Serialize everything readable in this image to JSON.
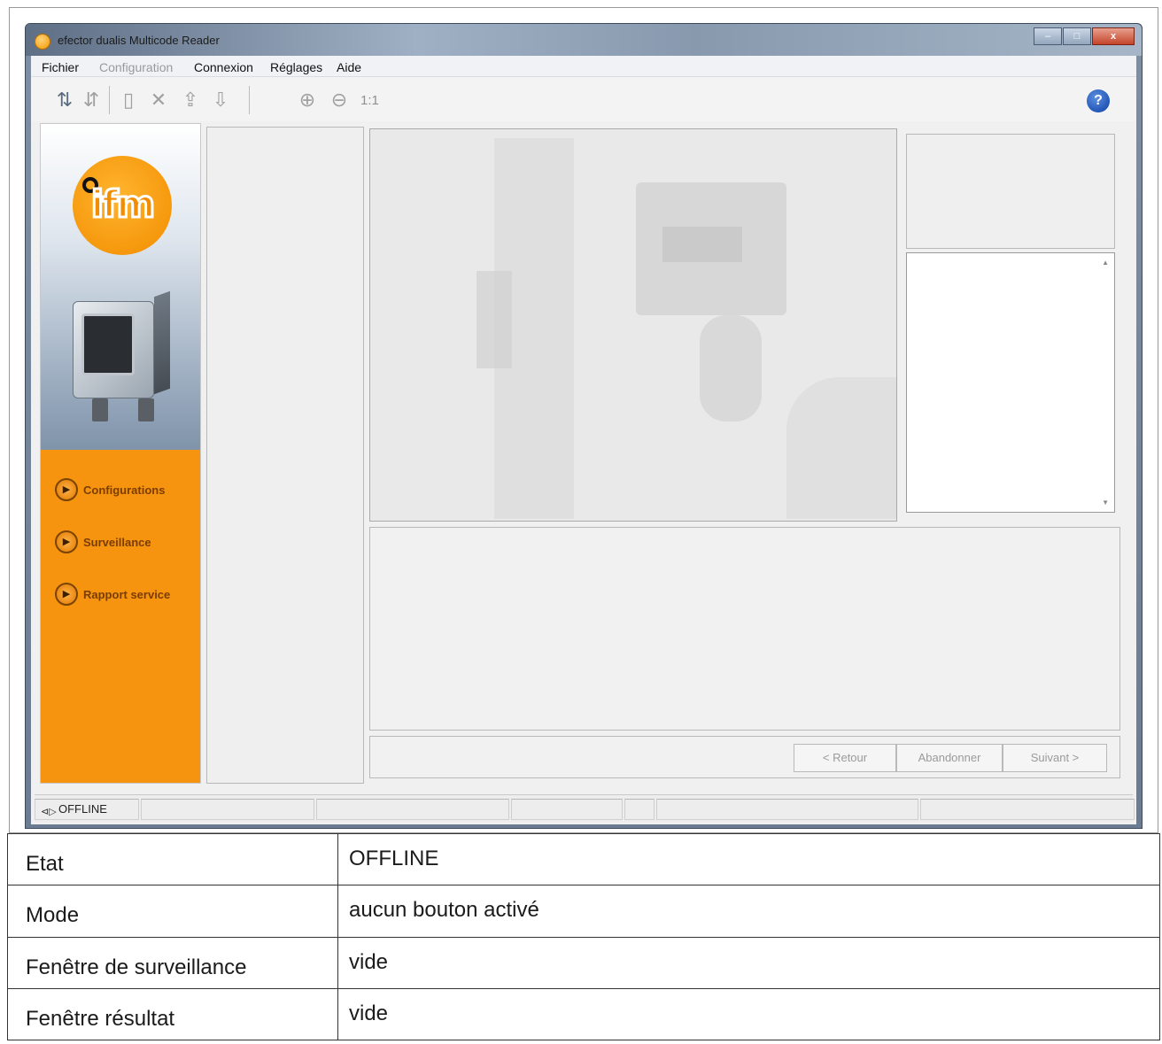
{
  "window": {
    "title": "efector dualis Multicode Reader",
    "buttons": {
      "minimize": "–",
      "maximize": "□",
      "close": "x"
    }
  },
  "menu": [
    {
      "label": "Fichier",
      "enabled": true
    },
    {
      "label": "Configuration",
      "enabled": false
    },
    {
      "label": "Connexion",
      "enabled": true
    },
    {
      "label": "Réglages",
      "enabled": true
    },
    {
      "label": "Aide",
      "enabled": true
    }
  ],
  "toolbar": {
    "icons": [
      "connect-icon",
      "disconnect-icon",
      "new-file-icon",
      "delete-icon",
      "upload-icon",
      "download-icon",
      "zoom-in-icon",
      "zoom-out-icon"
    ],
    "zoom_label": "1:1",
    "help_icon": "help-icon"
  },
  "sidebar": {
    "items": [
      {
        "label": "Configurations"
      },
      {
        "label": "Surveillance"
      },
      {
        "label": "Rapport service"
      }
    ]
  },
  "wizard": {
    "back": "< Retour",
    "abort": "Abandonner",
    "next": "Suivant >"
  },
  "status": {
    "state": "OFFLINE"
  },
  "table": [
    {
      "label": "Etat",
      "value": "OFFLINE"
    },
    {
      "label": "Mode",
      "value": "aucun bouton activé"
    },
    {
      "label": "Fenêtre de surveillance",
      "value": "vide"
    },
    {
      "label": "Fenêtre résultat",
      "value": "vide"
    }
  ],
  "colors": {
    "accent": "#f7940f",
    "window_frame": "#6b7c92"
  }
}
